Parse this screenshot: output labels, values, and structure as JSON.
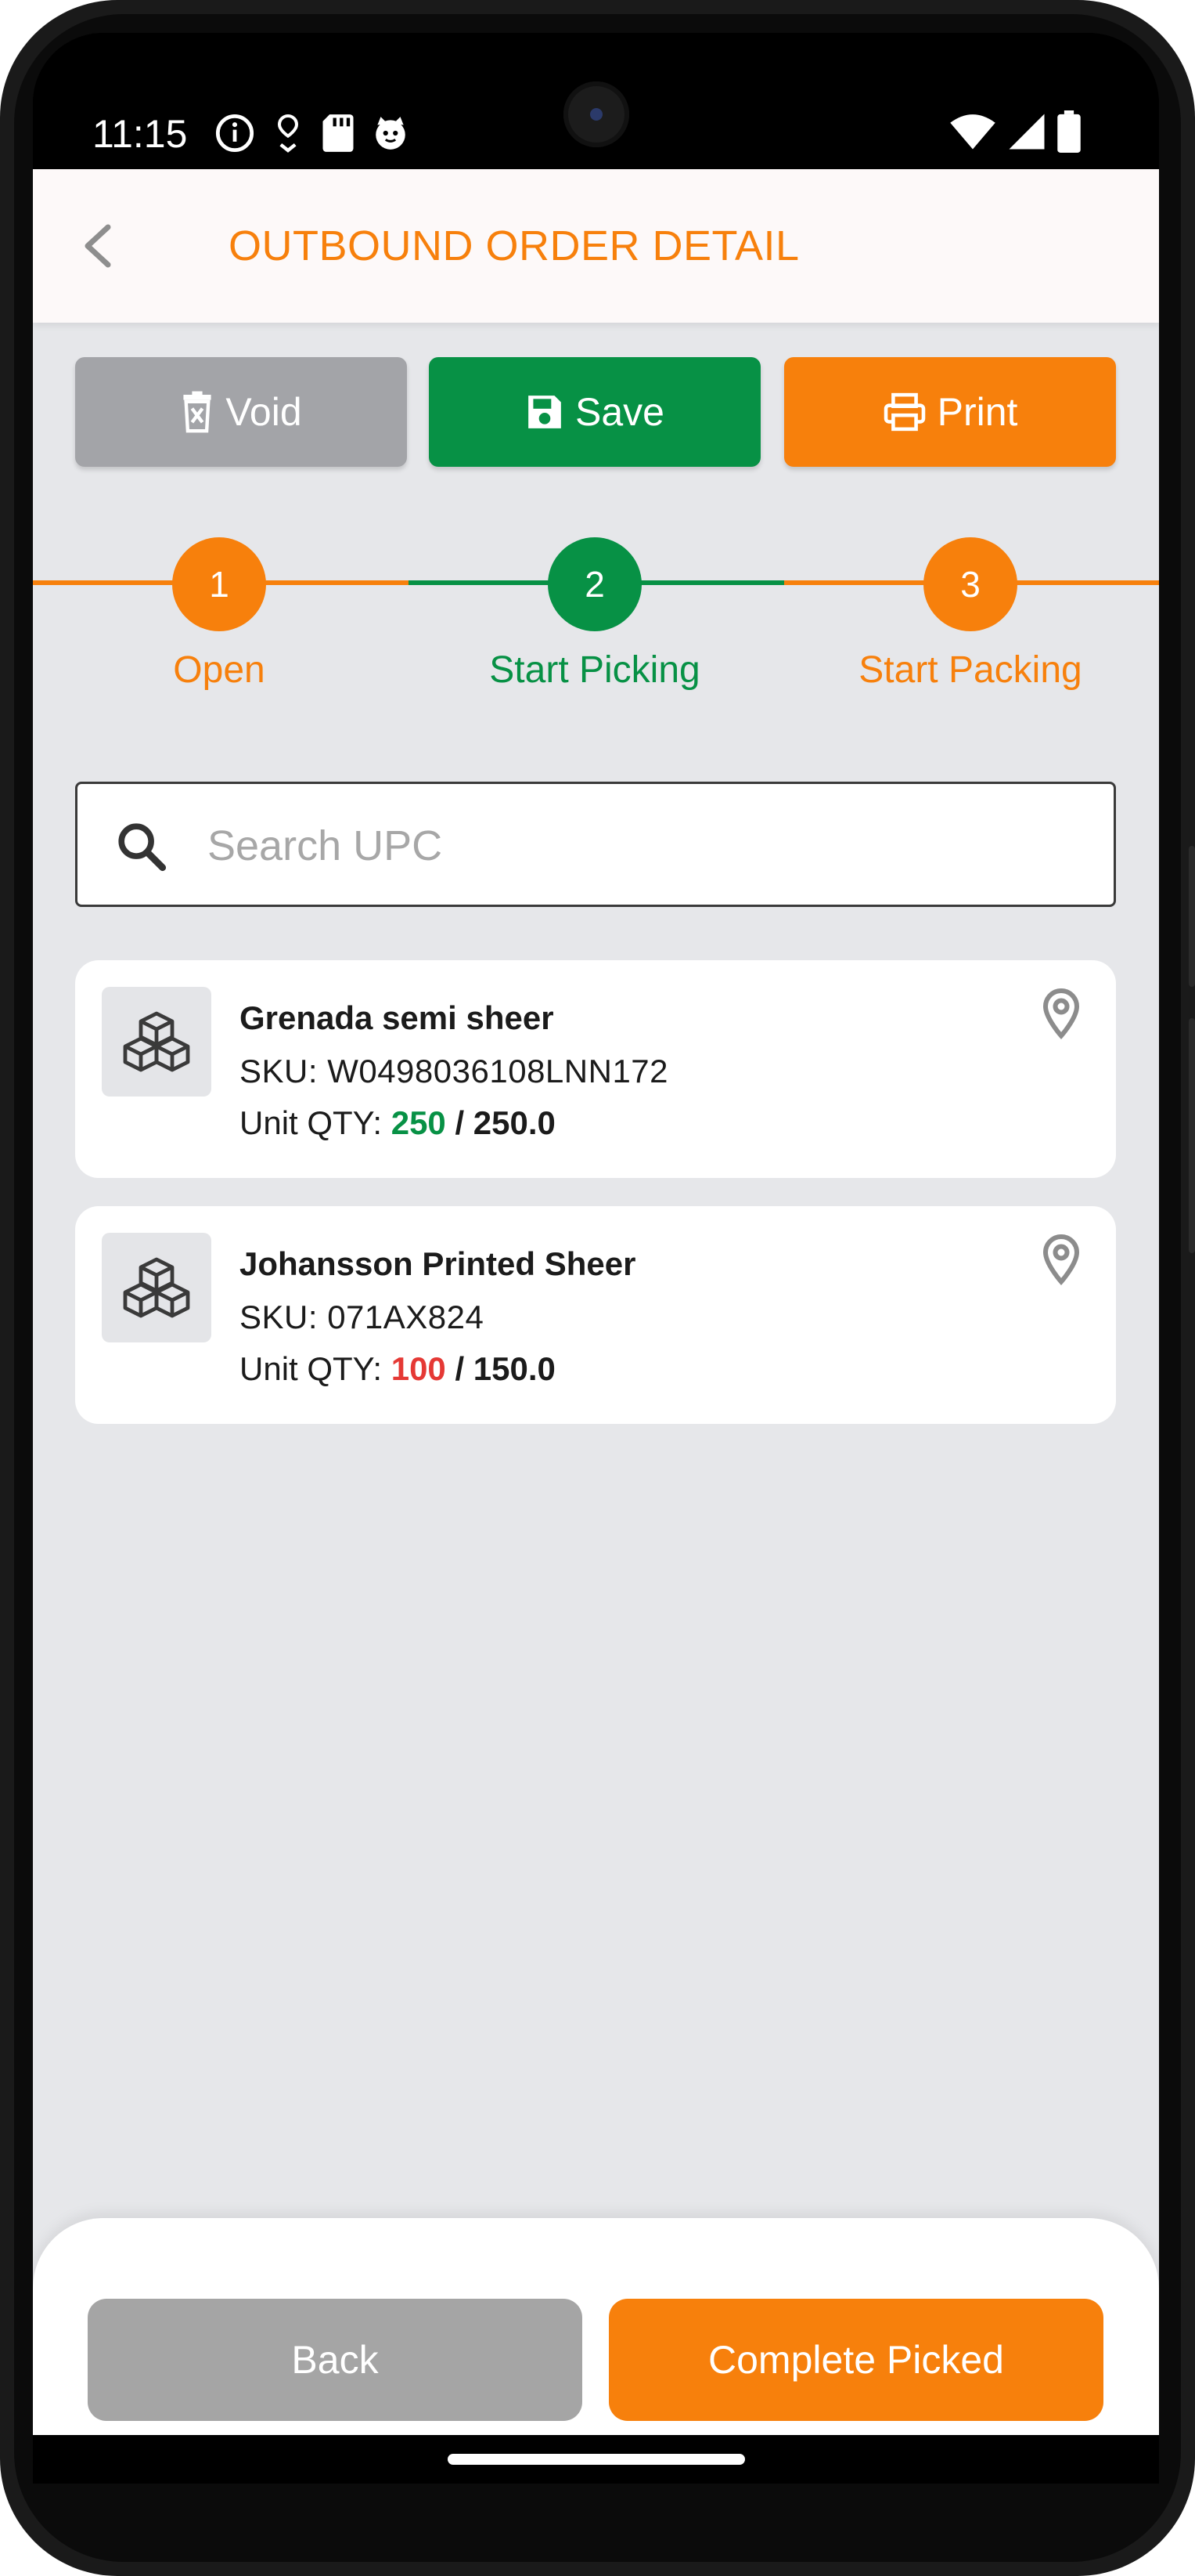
{
  "status_bar": {
    "time": "11:15",
    "left_icons": [
      "info-icon",
      "location-download-icon",
      "sd-card-icon",
      "cat-face-icon"
    ],
    "right_icons": [
      "wifi-icon",
      "signal-icon",
      "battery-icon"
    ]
  },
  "header": {
    "title": "OUTBOUND ORDER DETAIL",
    "back_icon": "chevron-left-icon"
  },
  "actions": {
    "void_label": "Void",
    "save_label": "Save",
    "print_label": "Print"
  },
  "stepper": {
    "steps": [
      {
        "number": "1",
        "label": "Open",
        "color": "#f7800c"
      },
      {
        "number": "2",
        "label": "Start Picking",
        "color": "#079145"
      },
      {
        "number": "3",
        "label": "Start Packing",
        "color": "#f7800c"
      }
    ],
    "active_step": 2
  },
  "search": {
    "placeholder": "Search UPC",
    "value": ""
  },
  "items": [
    {
      "name": "Grenada semi sheer",
      "sku": "SKU: W0498036108LNN172",
      "qty_label": "Unit QTY: ",
      "qty_picked": "250",
      "qty_total": " / 250.0",
      "qty_status": "complete"
    },
    {
      "name": "Johansson Printed Sheer",
      "sku": "SKU: 071AX824",
      "qty_label": "Unit QTY: ",
      "qty_picked": "100",
      "qty_total": " / 150.0",
      "qty_status": "short"
    }
  ],
  "footer": {
    "back_label": "Back",
    "complete_label": "Complete Picked"
  },
  "colors": {
    "accent": "#f7800c",
    "success": "#079145",
    "danger": "#e53935",
    "neutral_button": "#a5a5a5",
    "background": "#e6e7ea"
  }
}
